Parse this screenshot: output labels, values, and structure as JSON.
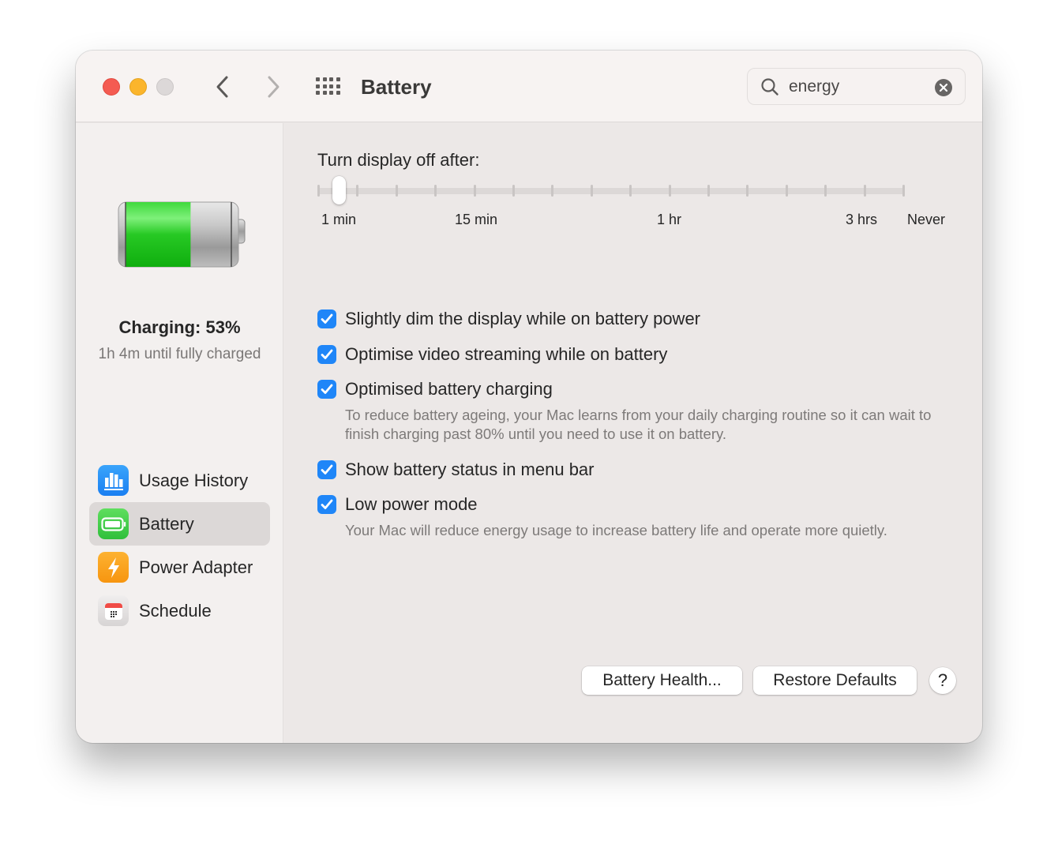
{
  "window": {
    "title": "Battery",
    "traffic_lights": [
      "close",
      "minimize",
      "zoom"
    ],
    "nav": {
      "back_icon": "chevron-left-icon",
      "forward_icon": "chevron-right-icon",
      "grid_icon": "show-all-grid-icon"
    }
  },
  "search": {
    "value": "energy",
    "icon": "search-icon",
    "clear_icon": "clear-icon"
  },
  "sidebar": {
    "battery_level_percent": 53,
    "charge_status": "Charging: 53%",
    "charge_time": "1h 4m until fully charged",
    "items": [
      {
        "label": "Usage History",
        "icon": "usage-history-icon",
        "active": false
      },
      {
        "label": "Battery",
        "icon": "battery-icon",
        "active": true
      },
      {
        "label": "Power Adapter",
        "icon": "power-adapter-icon",
        "active": false
      },
      {
        "label": "Schedule",
        "icon": "schedule-icon",
        "active": false
      }
    ]
  },
  "main": {
    "slider": {
      "title": "Turn display off after:",
      "labels": [
        "1 min",
        "15 min",
        "1 hr",
        "3 hrs",
        "Never"
      ],
      "tick_count": 16,
      "current_value": "2 min"
    },
    "options": [
      {
        "label": "Slightly dim the display while on battery power",
        "checked": true
      },
      {
        "label": "Optimise video streaming while on battery",
        "checked": true
      },
      {
        "label": "Optimised battery charging",
        "checked": true,
        "description": "To reduce battery ageing, your Mac learns from your daily charging routine so it can wait to finish charging past 80% until you need to use it on battery."
      },
      {
        "label": "Show battery status in menu bar",
        "checked": true
      },
      {
        "label": "Low power mode",
        "checked": true,
        "description": "Your Mac will reduce energy usage to increase battery life and operate more quietly."
      }
    ],
    "buttons": {
      "battery_health": "Battery Health...",
      "restore_defaults": "Restore Defaults",
      "help": "?"
    }
  },
  "colors": {
    "accent": "#1f86f8",
    "battery_green": "#22c41f",
    "close": "#f45b52",
    "minimize": "#fbb52c"
  }
}
